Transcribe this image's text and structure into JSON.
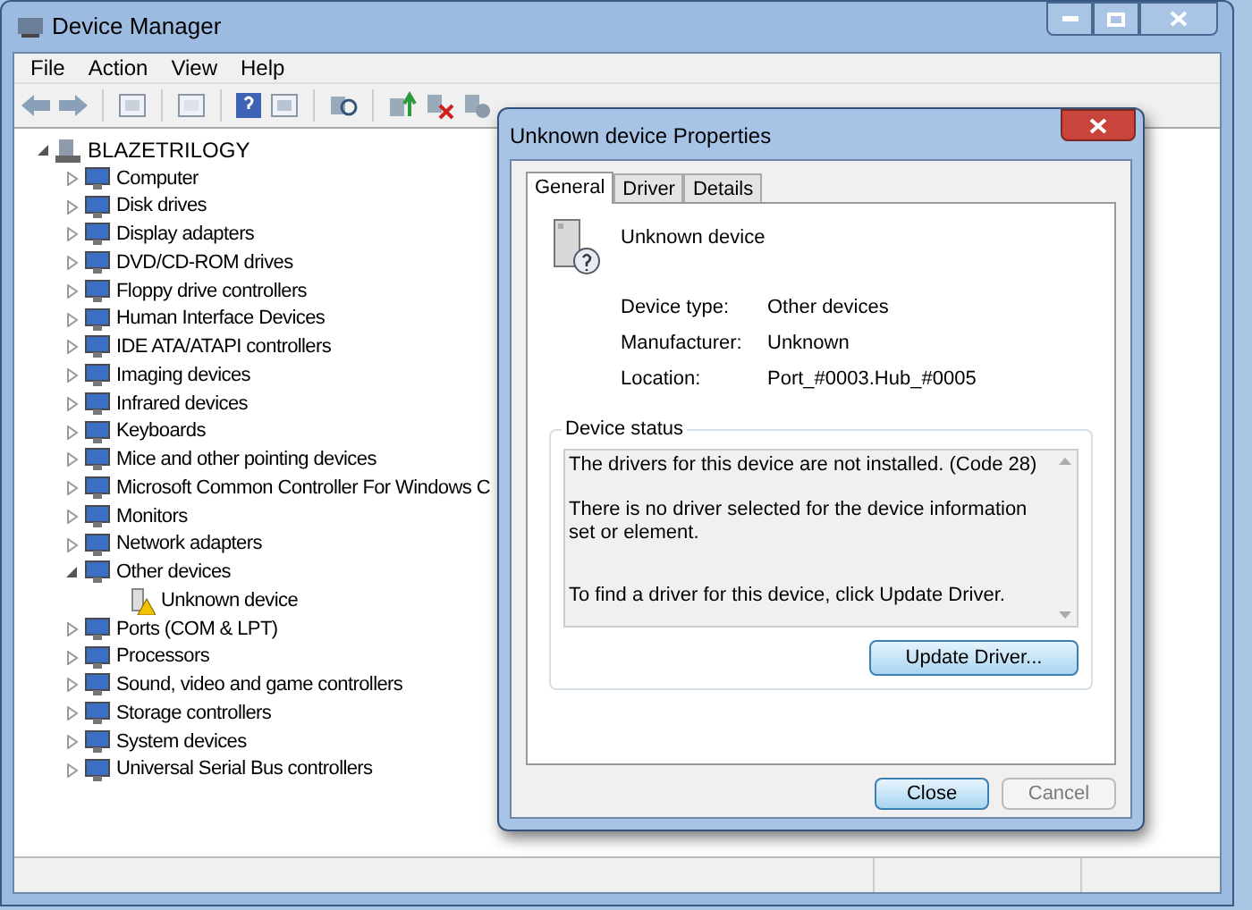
{
  "window": {
    "title": "Device Manager"
  },
  "menu": [
    "File",
    "Action",
    "View",
    "Help"
  ],
  "tree": {
    "label": "BLAZETRILOGY",
    "expanded": true,
    "children": [
      {
        "label": "Computer",
        "expanded": false
      },
      {
        "label": "Disk drives",
        "expanded": false
      },
      {
        "label": "Display adapters",
        "expanded": false
      },
      {
        "label": "DVD/CD-ROM drives",
        "expanded": false
      },
      {
        "label": "Floppy drive controllers",
        "expanded": false
      },
      {
        "label": "Human Interface Devices",
        "expanded": false
      },
      {
        "label": "IDE ATA/ATAPI controllers",
        "expanded": false
      },
      {
        "label": "Imaging devices",
        "expanded": false
      },
      {
        "label": "Infrared devices",
        "expanded": false
      },
      {
        "label": "Keyboards",
        "expanded": false
      },
      {
        "label": "Mice and other pointing devices",
        "expanded": false
      },
      {
        "label": "Microsoft Common Controller For Windows C",
        "expanded": false
      },
      {
        "label": "Monitors",
        "expanded": false
      },
      {
        "label": "Network adapters",
        "expanded": false
      },
      {
        "label": "Other devices",
        "expanded": true,
        "children": [
          {
            "label": "Unknown device",
            "warning": true
          }
        ]
      },
      {
        "label": "Ports (COM & LPT)",
        "expanded": false
      },
      {
        "label": "Processors",
        "expanded": false
      },
      {
        "label": "Sound, video and game controllers",
        "expanded": false
      },
      {
        "label": "Storage controllers",
        "expanded": false
      },
      {
        "label": "System devices",
        "expanded": false
      },
      {
        "label": "Universal Serial Bus controllers",
        "expanded": false
      }
    ]
  },
  "dialog": {
    "title": "Unknown device Properties",
    "tabs": [
      {
        "label": "General",
        "selected": true
      },
      {
        "label": "Driver",
        "selected": false
      },
      {
        "label": "Details",
        "selected": false
      }
    ],
    "device_name": "Unknown device",
    "properties": [
      {
        "label": "Device type:",
        "value": "Other devices"
      },
      {
        "label": "Manufacturer:",
        "value": "Unknown"
      },
      {
        "label": "Location:",
        "value": "Port_#0003.Hub_#0005"
      }
    ],
    "status_title": "Device status",
    "status_text": [
      "The drivers for this device are not installed. (Code 28)",
      "There is no driver selected for the device information set or element.",
      "To find a driver for this device, click Update Driver."
    ],
    "update_button": "Update Driver...",
    "buttons": [
      {
        "label": "Close",
        "disabled": false,
        "default": true
      },
      {
        "label": "Cancel",
        "disabled": true,
        "default": false
      }
    ]
  }
}
